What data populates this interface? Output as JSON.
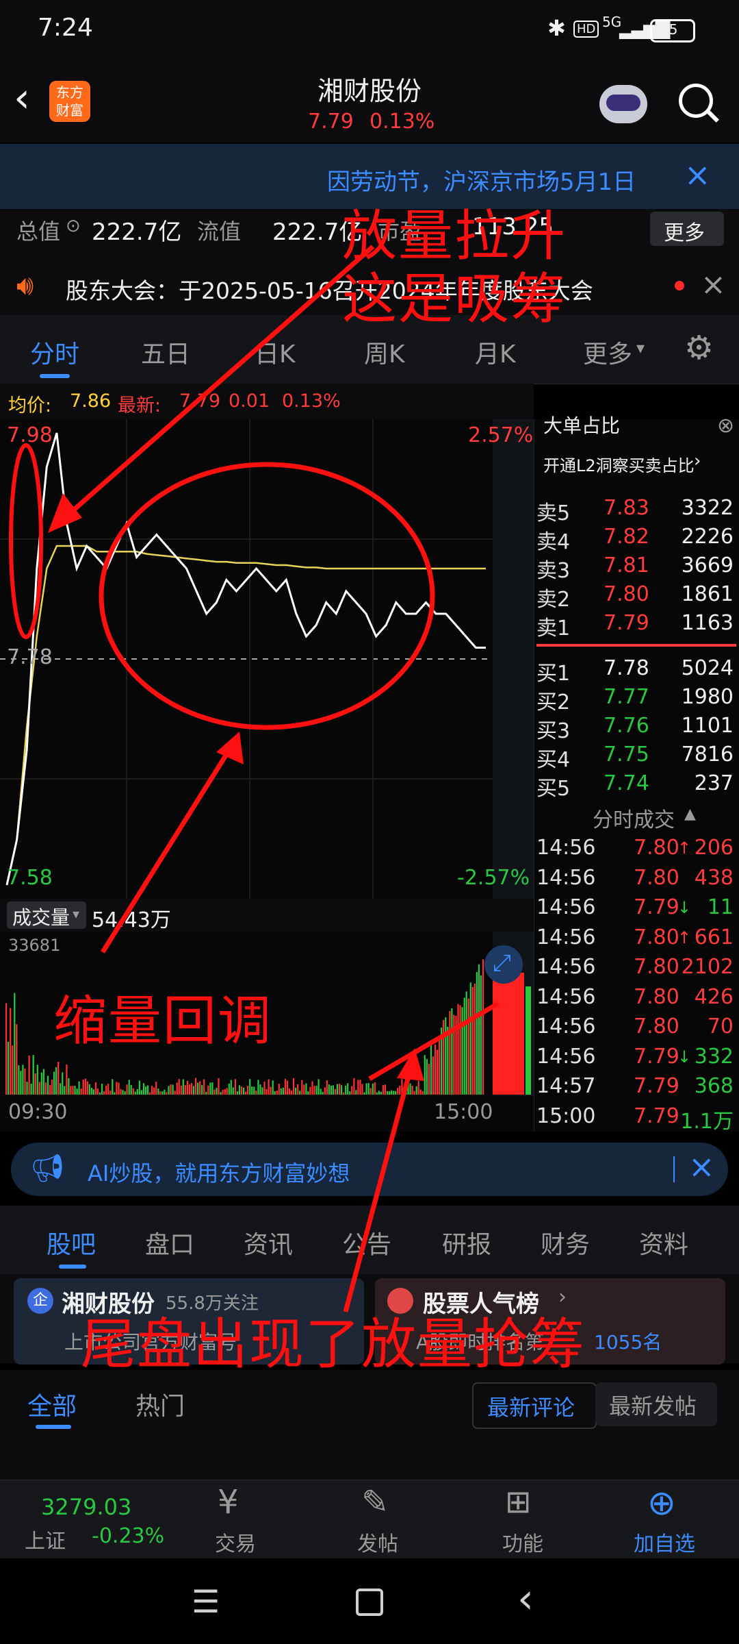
{
  "status_bar": {
    "time": "7:24",
    "battery": "35",
    "network": "5G"
  },
  "header": {
    "title": "湘财股份",
    "price": "7.79",
    "change_pct": "0.13%",
    "logo_text": "东方财富"
  },
  "notice": {
    "text": "因劳动节，沪深京市场5月1日"
  },
  "stats": {
    "total_value_label": "总值",
    "total_value": "222.7亿",
    "float_value_label": "流值",
    "float_value": "222.7亿",
    "pe_label": "市盈",
    "pe_value": "113.25",
    "more": "更多"
  },
  "meeting": {
    "text": "股东大会：于2025-05-16召开2024年年度股东大会"
  },
  "chart_tabs": [
    "分时",
    "五日",
    "日K",
    "周K",
    "月K",
    "更多"
  ],
  "avg_line": {
    "avg_label": "均价:",
    "avg_value": "7.86",
    "latest_label": "最新:",
    "latest_value": "7.79",
    "change": "0.01",
    "pct": "0.13%"
  },
  "chart_labels": {
    "price_high": "7.98",
    "price_pre": "7.78",
    "price_low": "7.58",
    "pct_high": "2.57%",
    "pct_low": "-2.57%"
  },
  "volume": {
    "label": "成交量",
    "value": "54.43万",
    "max": "33681"
  },
  "time_axis": {
    "start": "09:30",
    "end": "15:00"
  },
  "order_book": {
    "big_order_label": "大单占比",
    "l2_text": "开通L2洞察买卖占比",
    "asks": [
      {
        "label": "卖5",
        "price": "7.83",
        "vol": "3322"
      },
      {
        "label": "卖4",
        "price": "7.82",
        "vol": "2226"
      },
      {
        "label": "卖3",
        "price": "7.81",
        "vol": "3669"
      },
      {
        "label": "卖2",
        "price": "7.80",
        "vol": "1861"
      },
      {
        "label": "卖1",
        "price": "7.79",
        "vol": "1163"
      }
    ],
    "bids": [
      {
        "label": "买1",
        "price": "7.78",
        "vol": "5024"
      },
      {
        "label": "买2",
        "price": "7.77",
        "vol": "1980"
      },
      {
        "label": "买3",
        "price": "7.76",
        "vol": "1101"
      },
      {
        "label": "买4",
        "price": "7.75",
        "vol": "7816"
      },
      {
        "label": "买5",
        "price": "7.74",
        "vol": "237"
      }
    ],
    "ticks_title": "分时成交",
    "ticks": [
      {
        "t": "14:56",
        "p": "7.80",
        "arrow": "↑",
        "v": "206",
        "dir": "up"
      },
      {
        "t": "14:56",
        "p": "7.80",
        "arrow": "",
        "v": "438",
        "dir": "up"
      },
      {
        "t": "14:56",
        "p": "7.79",
        "arrow": "↓",
        "v": "11",
        "dir": "down"
      },
      {
        "t": "14:56",
        "p": "7.80",
        "arrow": "↑",
        "v": "661",
        "dir": "up"
      },
      {
        "t": "14:56",
        "p": "7.80",
        "arrow": "",
        "v": "2102",
        "dir": "up"
      },
      {
        "t": "14:56",
        "p": "7.80",
        "arrow": "",
        "v": "426",
        "dir": "up"
      },
      {
        "t": "14:56",
        "p": "7.80",
        "arrow": "",
        "v": "70",
        "dir": "up"
      },
      {
        "t": "14:56",
        "p": "7.79",
        "arrow": "↓",
        "v": "332",
        "dir": "down"
      },
      {
        "t": "14:57",
        "p": "7.79",
        "arrow": "",
        "v": "368",
        "dir": "down"
      },
      {
        "t": "15:00",
        "p": "7.79",
        "arrow": "",
        "v": "1.1万",
        "dir": "down"
      }
    ]
  },
  "ad": {
    "text": "AI炒股，就用东方财富妙想"
  },
  "sub_tabs": [
    "股吧",
    "盘口",
    "资讯",
    "公告",
    "研报",
    "财务",
    "资料"
  ],
  "cards": {
    "card1_title": "湘财股份",
    "card1_follow": "55.8万关注",
    "card1_sub": "上市公司官方财富号",
    "card2_title": "股票人气榜",
    "card2_sub": "A股即时排名第",
    "card2_rank": "1055名"
  },
  "filter": {
    "all": "全部",
    "hot": "热门",
    "latest_comment": "最新评论",
    "latest_post": "最新发帖"
  },
  "bottom_nav": {
    "index_value": "3279.03",
    "index_name": "上证",
    "index_pct": "-0.23%",
    "trade": "交易",
    "post": "发帖",
    "func": "功能",
    "add": "加自选"
  },
  "annotations": {
    "a1_line1": "放量拉升",
    "a1_line2": "这是吸筹",
    "a2": "缩量回调",
    "a3": "尾盘出现了放量抢筹"
  },
  "colors": {
    "up": "#ff3b3b",
    "down": "#28c840",
    "accent": "#3d8cff",
    "annotation": "#ff1010"
  },
  "chart_data": {
    "type": "line",
    "series": [
      {
        "values": [
          7.58,
          7.62,
          7.7,
          7.86,
          7.95,
          7.98,
          7.9,
          7.86,
          7.88,
          7.87,
          7.86,
          7.88,
          7.9,
          7.87,
          7.88,
          7.89,
          7.88,
          7.87,
          7.86,
          7.84,
          7.82,
          7.83,
          7.85,
          7.84,
          7.85,
          7.86,
          7.85,
          7.84,
          7.85,
          7.82,
          7.8,
          7.81,
          7.83,
          7.82,
          7.84,
          7.83,
          7.82,
          7.8,
          7.81,
          7.83,
          7.82,
          7.82,
          7.83,
          7.82,
          7.82,
          7.81,
          7.8,
          7.79,
          7.79
        ]
      },
      {
        "values": [
          7.58,
          7.62,
          7.72,
          7.8,
          7.86,
          7.88,
          7.88,
          7.88,
          7.88,
          7.875,
          7.875,
          7.875,
          7.875,
          7.875,
          7.873,
          7.872,
          7.871,
          7.87,
          7.869,
          7.868,
          7.867,
          7.866,
          7.866,
          7.865,
          7.865,
          7.865,
          7.864,
          7.863,
          7.863,
          7.862,
          7.861,
          7.861,
          7.86,
          7.86,
          7.86,
          7.86,
          7.86,
          7.86,
          7.86,
          7.86,
          7.86,
          7.86,
          7.86,
          7.86,
          7.86,
          7.86,
          7.86,
          7.86,
          7.86
        ]
      }
    ],
    "ylim": [
      7.58,
      7.98
    ]
  }
}
